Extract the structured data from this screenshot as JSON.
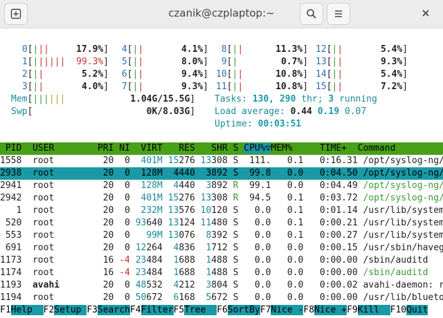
{
  "window": {
    "title": "czanik@czplaptop:~"
  },
  "cpus": [
    {
      "id": "0",
      "bar": "|||",
      "pct": "17.9%"
    },
    {
      "id": "1",
      "bar": "||||||",
      "pct": "99.3%"
    },
    {
      "id": "2",
      "bar": "||",
      "pct": "5.2%"
    },
    {
      "id": "3",
      "bar": "||",
      "pct": "4.0%"
    },
    {
      "id": "4",
      "bar": "||",
      "pct": "4.1%"
    },
    {
      "id": "5",
      "bar": "||",
      "pct": "8.0%"
    },
    {
      "id": "6",
      "bar": "||",
      "pct": "9.4%"
    },
    {
      "id": "7",
      "bar": "||",
      "pct": "9.3%"
    },
    {
      "id": "8",
      "bar": "||",
      "pct": "11.3%"
    },
    {
      "id": "9",
      "bar": "|",
      "pct": "0.7%"
    },
    {
      "id": "10",
      "bar": "||",
      "pct": "10.8%"
    },
    {
      "id": "11",
      "bar": "||",
      "pct": "10.8%"
    },
    {
      "id": "12",
      "bar": "||",
      "pct": "5.4%"
    },
    {
      "id": "13",
      "bar": "||",
      "pct": "9.3%"
    },
    {
      "id": "14",
      "bar": "||",
      "pct": "5.4%"
    },
    {
      "id": "15",
      "bar": "||",
      "pct": "7.2%"
    }
  ],
  "mem": {
    "label": "Mem",
    "bar": "||||||",
    "value": "1.04G/15.5G"
  },
  "swp": {
    "label": "Swp",
    "bar": "",
    "value": "0K/8.03G"
  },
  "tasks": {
    "label": "Tasks:",
    "count": "130,",
    "thr": "290",
    "thr_label": "thr;",
    "running": "3",
    "running_label": "running"
  },
  "load": {
    "label": "Load average:",
    "l1": "0.44",
    "l5": "0.19",
    "l15": "0.07"
  },
  "uptime": {
    "label": "Uptime:",
    "value": "00:03:51"
  },
  "columns": [
    "PID",
    "USER",
    "PRI",
    "NI",
    "VIRT",
    "RES",
    "SHR",
    "S",
    "CPU%▽",
    "MEM%",
    "TIME+",
    "Command"
  ],
  "processes": [
    {
      "pid": "1558",
      "user": "root",
      "pri": "20",
      "ni": "0",
      "virt": "401M",
      "res": "15276",
      "shr": "13308",
      "s": "S",
      "cpu": "111.",
      "mem": "0.1",
      "time": "0:16.31",
      "cmd": "/opt/syslog-ng/l"
    },
    {
      "pid": "2938",
      "user": "root",
      "pri": "20",
      "ni": "0",
      "virt": "128M",
      "res": "4440",
      "shr": "3892",
      "s": "S",
      "cpu": "99.8",
      "mem": "0.0",
      "time": "0:04.50",
      "cmd": "/opt/syslog-ng/l"
    },
    {
      "pid": "2941",
      "user": "root",
      "pri": "20",
      "ni": "0",
      "virt": "128M",
      "res": "4440",
      "shr": "3892",
      "s": "R",
      "cpu": "99.1",
      "mem": "0.0",
      "time": "0:04.49",
      "cmd": "/opt/syslog-ng/l"
    },
    {
      "pid": "2942",
      "user": "root",
      "pri": "20",
      "ni": "0",
      "virt": "401M",
      "res": "15276",
      "shr": "13308",
      "s": "R",
      "cpu": "94.5",
      "mem": "0.1",
      "time": "0:03.72",
      "cmd": "/opt/syslog-ng/l"
    },
    {
      "pid": "1",
      "user": "root",
      "pri": "20",
      "ni": "0",
      "virt": "232M",
      "res": "13576",
      "shr": "10120",
      "s": "S",
      "cpu": "0.0",
      "mem": "0.1",
      "time": "0:01.14",
      "cmd": "/usr/lib/systemd"
    },
    {
      "pid": "520",
      "user": "root",
      "pri": "20",
      "ni": "0",
      "virt": "93640",
      "res": "13124",
      "shr": "11480",
      "s": "S",
      "cpu": "0.0",
      "mem": "0.1",
      "time": "0:00.21",
      "cmd": "/usr/lib/systemd"
    },
    {
      "pid": "553",
      "user": "root",
      "pri": "20",
      "ni": "0",
      "virt": "99M",
      "res": "13076",
      "shr": "8392",
      "s": "S",
      "cpu": "0.0",
      "mem": "0.1",
      "time": "0:00.27",
      "cmd": "/usr/lib/systemd"
    },
    {
      "pid": "691",
      "user": "root",
      "pri": "20",
      "ni": "0",
      "virt": "12264",
      "res": "4836",
      "shr": "1712",
      "s": "S",
      "cpu": "0.0",
      "mem": "0.0",
      "time": "0:00.15",
      "cmd": "/usr/sbin/havege"
    },
    {
      "pid": "1173",
      "user": "root",
      "pri": "16",
      "ni": "-4",
      "virt": "23484",
      "res": "1688",
      "shr": "1488",
      "s": "S",
      "cpu": "0.0",
      "mem": "0.0",
      "time": "0:00.00",
      "cmd": "/sbin/auditd"
    },
    {
      "pid": "1174",
      "user": "root",
      "pri": "16",
      "ni": "-4",
      "virt": "23484",
      "res": "1688",
      "shr": "1488",
      "s": "S",
      "cpu": "0.0",
      "mem": "0.0",
      "time": "0:00.00",
      "cmd": "/sbin/auditd"
    },
    {
      "pid": "1193",
      "user": "avahi",
      "pri": "20",
      "ni": "0",
      "virt": "48532",
      "res": "4212",
      "shr": "3804",
      "s": "S",
      "cpu": "0.0",
      "mem": "0.0",
      "time": "0:00.02",
      "cmd": "avahi-daemon: ru"
    },
    {
      "pid": "1194",
      "user": "root",
      "pri": "20",
      "ni": "0",
      "virt": "50672",
      "res": "6168",
      "shr": "5672",
      "s": "S",
      "cpu": "0.0",
      "mem": "0.0",
      "time": "0:00.00",
      "cmd": "/usr/lib/bluetoo"
    }
  ],
  "fkeys": [
    {
      "key": "F1",
      "label": "Help  "
    },
    {
      "key": "F2",
      "label": "Setup "
    },
    {
      "key": "F3",
      "label": "Search"
    },
    {
      "key": "F4",
      "label": "Filter"
    },
    {
      "key": "F5",
      "label": "Tree  "
    },
    {
      "key": "F6",
      "label": "SortBy"
    },
    {
      "key": "F7",
      "label": "Nice -"
    },
    {
      "key": "F8",
      "label": "Nice +"
    },
    {
      "key": "F9",
      "label": "Kill  "
    },
    {
      "key": "F10",
      "label": "Quit"
    }
  ]
}
